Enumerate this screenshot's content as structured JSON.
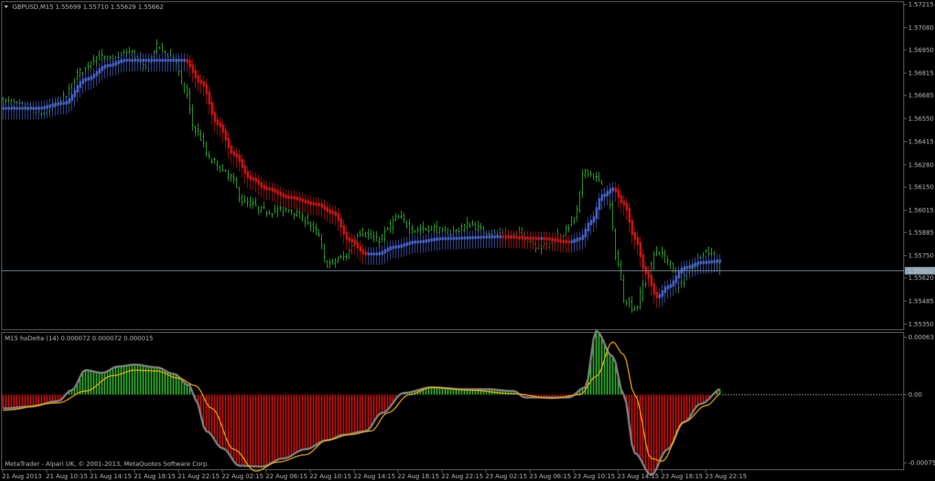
{
  "chart_header": "GBPUSD,M15  1.55699 1.55710 1.55629 1.55662",
  "indicator_header": "M15 haDelta (14) 0.000072 0.000072 0.000015",
  "copyright": "MetaTrader - Alpari UK, © 2001-2013, MetaQuotes Software Corp.",
  "colors": {
    "background": "#000000",
    "grid_border": "#7a7a7a",
    "bar_up": "#33c733",
    "ha_up": "#4d6be0",
    "ha_down": "#e01414",
    "current_price_line": "#8fa6b8",
    "current_price_box": "#8fa6b8",
    "delta_pos": "#2fc62f",
    "delta_neg": "#e01010",
    "signal": "#ffb400",
    "delta_line": "#808080",
    "zero_line": "#c8c8c8"
  },
  "chart_data": [
    {
      "type": "candlestick",
      "symbol": "GBPUSD",
      "timeframe": "M15",
      "last_bar": {
        "open": 1.55699,
        "high": 1.5571,
        "low": 1.55629,
        "close": 1.55662
      },
      "current_price_label": "1.55662",
      "current_price": 1.55662,
      "ylim": [
        1.5532,
        1.5723
      ],
      "y_tick_labels": [
        "1.57215",
        "1.57080",
        "1.56950",
        "1.56815",
        "1.56685",
        "1.56550",
        "1.56415",
        "1.56280",
        "1.56150",
        "1.56015",
        "1.55885",
        "1.55750",
        "1.55620",
        "1.55485",
        "1.55350"
      ],
      "x_tick_labels": [
        "21 Aug 2013",
        "21 Aug 10:15",
        "21 Aug 14:15",
        "21 Aug 18:15",
        "21 Aug 22:15",
        "22 Aug 02:15",
        "22 Aug 06:15",
        "22 Aug 10:15",
        "22 Aug 14:15",
        "22 Aug 18:15",
        "22 Aug 22:15",
        "23 Aug 02:15",
        "23 Aug 06:15",
        "23 Aug 10:15",
        "23 Aug 14:15",
        "23 Aug 18:15",
        "23 Aug 22:15"
      ],
      "bars_per_label": 16,
      "bar_count": 262,
      "close_keypoints": [
        [
          0,
          1.5665
        ],
        [
          8,
          1.5662
        ],
        [
          14,
          1.5658
        ],
        [
          22,
          1.5667
        ],
        [
          28,
          1.5682
        ],
        [
          34,
          1.5691
        ],
        [
          40,
          1.5689
        ],
        [
          46,
          1.5694
        ],
        [
          52,
          1.5684
        ],
        [
          56,
          1.5697
        ],
        [
          62,
          1.5691
        ],
        [
          66,
          1.5672
        ],
        [
          70,
          1.5648
        ],
        [
          76,
          1.563
        ],
        [
          82,
          1.5622
        ],
        [
          88,
          1.5606
        ],
        [
          96,
          1.5601
        ],
        [
          104,
          1.5602
        ],
        [
          110,
          1.5596
        ],
        [
          114,
          1.5589
        ],
        [
          118,
          1.557
        ],
        [
          124,
          1.5574
        ],
        [
          130,
          1.5589
        ],
        [
          136,
          1.5584
        ],
        [
          144,
          1.5597
        ],
        [
          150,
          1.559
        ],
        [
          156,
          1.5591
        ],
        [
          162,
          1.5588
        ],
        [
          170,
          1.5593
        ],
        [
          176,
          1.5589
        ],
        [
          182,
          1.5586
        ],
        [
          188,
          1.5587
        ],
        [
          196,
          1.558
        ],
        [
          204,
          1.5588
        ],
        [
          208,
          1.5597
        ],
        [
          212,
          1.5625
        ],
        [
          216,
          1.562
        ],
        [
          220,
          1.561
        ],
        [
          224,
          1.557
        ],
        [
          226,
          1.555
        ],
        [
          230,
          1.5544
        ],
        [
          234,
          1.556
        ],
        [
          238,
          1.5578
        ],
        [
          242,
          1.5572
        ],
        [
          246,
          1.5558
        ],
        [
          250,
          1.5568
        ],
        [
          256,
          1.5578
        ],
        [
          262,
          1.5566
        ]
      ],
      "heiken_ashi_keypoints": [
        [
          0,
          1.5661
        ],
        [
          12,
          1.5661
        ],
        [
          22,
          1.5664
        ],
        [
          30,
          1.5678
        ],
        [
          38,
          1.5686
        ],
        [
          44,
          1.5689
        ],
        [
          66,
          1.5689
        ],
        [
          72,
          1.5676
        ],
        [
          78,
          1.5652
        ],
        [
          84,
          1.5634
        ],
        [
          90,
          1.562
        ],
        [
          96,
          1.5614
        ],
        [
          104,
          1.5609
        ],
        [
          114,
          1.5605
        ],
        [
          120,
          1.56
        ],
        [
          126,
          1.5584
        ],
        [
          132,
          1.5576
        ],
        [
          136,
          1.5576
        ],
        [
          142,
          1.558
        ],
        [
          150,
          1.5583
        ],
        [
          160,
          1.5585
        ],
        [
          180,
          1.5586
        ],
        [
          196,
          1.5585
        ],
        [
          206,
          1.5583
        ],
        [
          210,
          1.5585
        ],
        [
          214,
          1.5595
        ],
        [
          218,
          1.561
        ],
        [
          222,
          1.5614
        ],
        [
          226,
          1.5605
        ],
        [
          230,
          1.5585
        ],
        [
          234,
          1.5565
        ],
        [
          238,
          1.5551
        ],
        [
          242,
          1.5557
        ],
        [
          248,
          1.5568
        ],
        [
          254,
          1.5571
        ],
        [
          262,
          1.5572
        ]
      ]
    },
    {
      "type": "histogram",
      "name": "haDelta (14)",
      "values_label": "0.000072 0.000072 0.000015",
      "ylim": [
        -0.00082,
        0.00068
      ],
      "y_tick_labels": [
        "0.00063",
        "0.00",
        "-0.00075"
      ],
      "delta_keypoints": [
        [
          0,
          -0.00015
        ],
        [
          10,
          -0.00013
        ],
        [
          20,
          -7e-05
        ],
        [
          25,
          5e-05
        ],
        [
          30,
          0.00027
        ],
        [
          36,
          0.00024
        ],
        [
          42,
          0.00031
        ],
        [
          48,
          0.00033
        ],
        [
          56,
          0.0003
        ],
        [
          62,
          0.00023
        ],
        [
          68,
          0.0001
        ],
        [
          70,
          -5e-05
        ],
        [
          74,
          -0.0004
        ],
        [
          80,
          -0.00059
        ],
        [
          86,
          -0.00078
        ],
        [
          94,
          -0.00079
        ],
        [
          102,
          -0.0007
        ],
        [
          110,
          -0.0006
        ],
        [
          118,
          -0.0005
        ],
        [
          124,
          -0.00044
        ],
        [
          132,
          -0.0004
        ],
        [
          138,
          -0.0002
        ],
        [
          146,
          2e-05
        ],
        [
          156,
          8e-05
        ],
        [
          168,
          6e-05
        ],
        [
          176,
          6e-05
        ],
        [
          186,
          4e-05
        ],
        [
          190,
          -3e-05
        ],
        [
          198,
          -3e-05
        ],
        [
          206,
          -3e-05
        ],
        [
          212,
          8e-05
        ],
        [
          216,
          0.0007
        ],
        [
          222,
          0.00042
        ],
        [
          226,
          0.0
        ],
        [
          230,
          -0.00064
        ],
        [
          236,
          -0.00088
        ],
        [
          242,
          -0.0006
        ],
        [
          248,
          -0.0003
        ],
        [
          254,
          -0.0001
        ],
        [
          262,
          7e-05
        ]
      ],
      "signal_keypoints": [
        [
          0,
          -0.00017
        ],
        [
          20,
          -9e-05
        ],
        [
          30,
          4e-05
        ],
        [
          40,
          0.00021
        ],
        [
          48,
          0.00027
        ],
        [
          56,
          0.00026
        ],
        [
          64,
          0.00018
        ],
        [
          70,
          0.0001
        ],
        [
          76,
          -0.00015
        ],
        [
          84,
          -0.0006
        ],
        [
          92,
          -0.00084
        ],
        [
          100,
          -0.00074
        ],
        [
          110,
          -0.00066
        ],
        [
          118,
          -0.0005
        ],
        [
          126,
          -0.00044
        ],
        [
          134,
          -0.0004
        ],
        [
          140,
          -0.0002
        ],
        [
          148,
          0.0
        ],
        [
          156,
          8e-05
        ],
        [
          170,
          5e-05
        ],
        [
          186,
          1e-05
        ],
        [
          200,
          -4e-05
        ],
        [
          210,
          0.0
        ],
        [
          216,
          0.0002
        ],
        [
          222,
          0.00058
        ],
        [
          226,
          0.00044
        ],
        [
          230,
          0.0
        ],
        [
          236,
          -0.0007
        ],
        [
          240,
          -0.00073
        ],
        [
          248,
          -0.0003
        ],
        [
          256,
          -0.00012
        ],
        [
          262,
          2e-05
        ]
      ]
    }
  ]
}
